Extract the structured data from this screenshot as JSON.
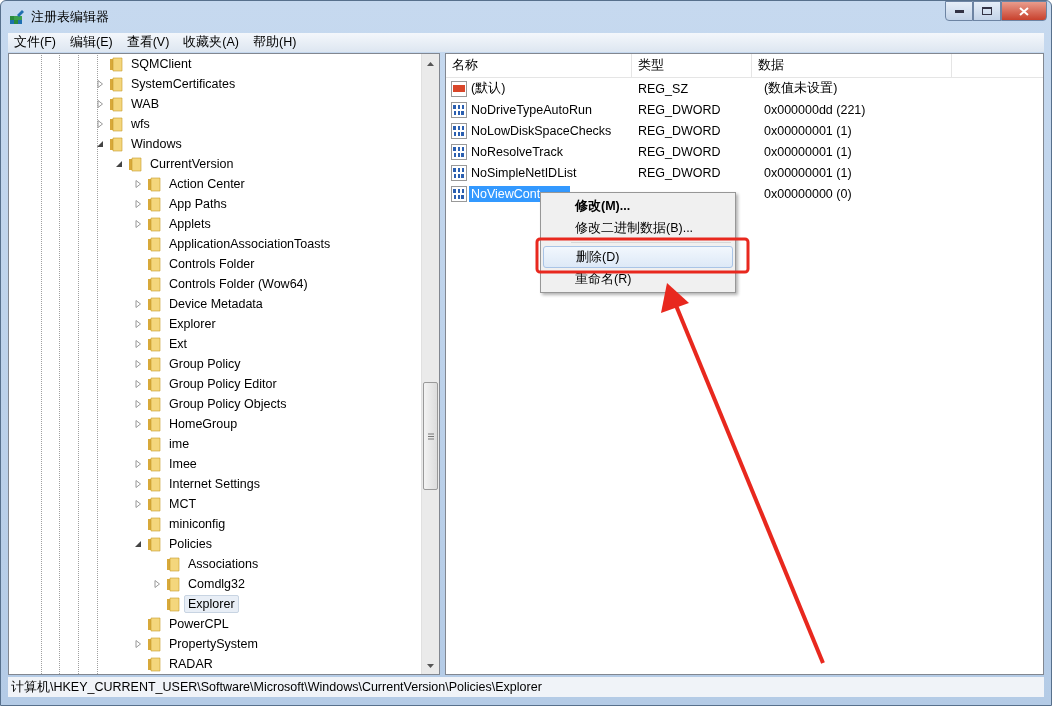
{
  "window": {
    "title": "注册表编辑器"
  },
  "menu": [
    "文件(F)",
    "编辑(E)",
    "查看(V)",
    "收藏夹(A)",
    "帮助(H)"
  ],
  "tree": [
    {
      "name": "SQMClient",
      "expandable": false,
      "selected": false
    },
    {
      "name": "SystemCertificates",
      "expandable": true,
      "expanded": false,
      "selected": false
    },
    {
      "name": "WAB",
      "expandable": true,
      "expanded": false,
      "selected": false
    },
    {
      "name": "wfs",
      "expandable": true,
      "expanded": false,
      "selected": false
    },
    {
      "name": "Windows",
      "expandable": true,
      "expanded": true,
      "selected": false,
      "children": [
        {
          "name": "CurrentVersion",
          "expandable": true,
          "expanded": true,
          "selected": false,
          "children": [
            {
              "name": "Action Center",
              "expandable": true,
              "expanded": false,
              "selected": false
            },
            {
              "name": "App Paths",
              "expandable": true,
              "expanded": false,
              "selected": false
            },
            {
              "name": "Applets",
              "expandable": true,
              "expanded": false,
              "selected": false
            },
            {
              "name": "ApplicationAssociationToasts",
              "expandable": false,
              "selected": false
            },
            {
              "name": "Controls Folder",
              "expandable": false,
              "selected": false
            },
            {
              "name": "Controls Folder (Wow64)",
              "expandable": false,
              "selected": false
            },
            {
              "name": "Device Metadata",
              "expandable": true,
              "expanded": false,
              "selected": false
            },
            {
              "name": "Explorer",
              "expandable": true,
              "expanded": false,
              "selected": false
            },
            {
              "name": "Ext",
              "expandable": true,
              "expanded": false,
              "selected": false
            },
            {
              "name": "Group Policy",
              "expandable": true,
              "expanded": false,
              "selected": false
            },
            {
              "name": "Group Policy Editor",
              "expandable": true,
              "expanded": false,
              "selected": false
            },
            {
              "name": "Group Policy Objects",
              "expandable": true,
              "expanded": false,
              "selected": false
            },
            {
              "name": "HomeGroup",
              "expandable": true,
              "expanded": false,
              "selected": false
            },
            {
              "name": "ime",
              "expandable": false,
              "selected": false
            },
            {
              "name": "Imee",
              "expandable": true,
              "expanded": false,
              "selected": false
            },
            {
              "name": "Internet Settings",
              "expandable": true,
              "expanded": false,
              "selected": false
            },
            {
              "name": "MCT",
              "expandable": true,
              "expanded": false,
              "selected": false
            },
            {
              "name": "miniconfig",
              "expandable": false,
              "selected": false
            },
            {
              "name": "Policies",
              "expandable": true,
              "expanded": true,
              "selected": false,
              "children": [
                {
                  "name": "Associations",
                  "expandable": false,
                  "selected": false
                },
                {
                  "name": "Comdlg32",
                  "expandable": true,
                  "expanded": false,
                  "selected": false
                },
                {
                  "name": "Explorer",
                  "expandable": false,
                  "selected": true
                }
              ]
            },
            {
              "name": "PowerCPL",
              "expandable": false,
              "selected": false
            },
            {
              "name": "PropertySystem",
              "expandable": true,
              "expanded": false,
              "selected": false
            },
            {
              "name": "RADAR",
              "expandable": false,
              "selected": false
            }
          ]
        }
      ]
    }
  ],
  "values": {
    "columns": [
      "名称",
      "类型",
      "数据"
    ],
    "rows": [
      {
        "kind": "string",
        "name": "(默认)",
        "type": "REG_SZ",
        "data": "(数值未设置)",
        "selected": false
      },
      {
        "kind": "dword",
        "name": "NoDriveTypeAutoRun",
        "type": "REG_DWORD",
        "data": "0x000000dd (221)",
        "selected": false
      },
      {
        "kind": "dword",
        "name": "NoLowDiskSpaceChecks",
        "type": "REG_DWORD",
        "data": "0x00000001 (1)",
        "selected": false
      },
      {
        "kind": "dword",
        "name": "NoResolveTrack",
        "type": "REG_DWORD",
        "data": "0x00000001 (1)",
        "selected": false
      },
      {
        "kind": "dword",
        "name": "NoSimpleNetIDList",
        "type": "REG_DWORD",
        "data": "0x00000001 (1)",
        "selected": false
      },
      {
        "kind": "dword",
        "name": "NoViewCont",
        "data": "0x00000000 (0)",
        "selected": true
      }
    ]
  },
  "context_menu": [
    {
      "kind": "item",
      "label": "修改(M)...",
      "default": true,
      "selected": false
    },
    {
      "kind": "item",
      "label": "修改二进制数据(B)...",
      "default": false,
      "selected": false
    },
    {
      "kind": "separator"
    },
    {
      "kind": "item",
      "label": "删除(D)",
      "default": false,
      "selected": true
    },
    {
      "kind": "item",
      "label": "重命名(R)",
      "default": false,
      "selected": false
    }
  ],
  "status_bar": "计算机\\HKEY_CURRENT_USER\\Software\\Microsoft\\Windows\\CurrentVersion\\Policies\\Explorer"
}
